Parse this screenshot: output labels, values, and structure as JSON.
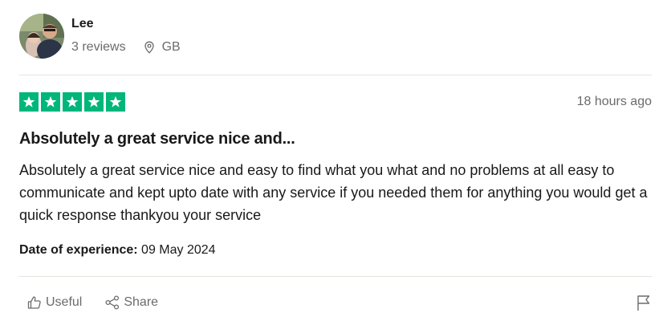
{
  "reviewer": {
    "name": "Lee",
    "reviews": "3 reviews",
    "location": "GB"
  },
  "review": {
    "rating": 5,
    "rating_max": 5,
    "star_color": "#00b67a",
    "time_ago": "18 hours ago",
    "title": "Absolutely a great service nice and...",
    "body": "Absolutely a great service nice and easy to find what you what and no problems at all easy to communicate and kept upto date with any service if you needed them for anything you would get a quick response thankyou your service",
    "date_label": "Date of experience:",
    "date_value": " 09 May 2024"
  },
  "actions": {
    "useful_label": "Useful",
    "share_label": "Share"
  },
  "icons": {
    "location": "location-pin-icon",
    "useful": "thumbs-up-icon",
    "share": "share-icon",
    "report": "flag-icon"
  }
}
